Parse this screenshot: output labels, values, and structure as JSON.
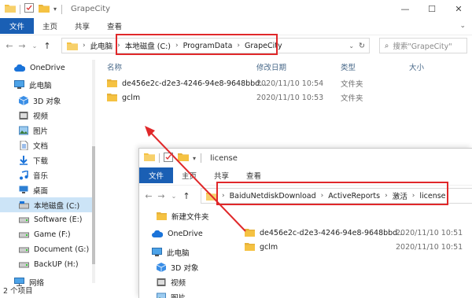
{
  "back_window": {
    "title": "GrapeCity",
    "ribbon_tabs": [
      "文件",
      "主页",
      "共享",
      "查看"
    ],
    "address_root": "此电脑",
    "address_crumbs": [
      "本地磁盘 (C:)",
      "ProgramData",
      "GrapeCity"
    ],
    "search_placeholder": "搜索\"GrapeCity\"",
    "columns": {
      "name": "名称",
      "modified": "修改日期",
      "type": "类型",
      "size": "大小"
    },
    "files": [
      {
        "name": "de456e2c-d2e3-4246-94e8-9648bbd...",
        "modified": "2020/11/10 10:54",
        "type": "文件夹"
      },
      {
        "name": "gclm",
        "modified": "2020/11/10 10:53",
        "type": "文件夹"
      }
    ],
    "nav": {
      "onedrive": "OneDrive",
      "this_pc": "此电脑",
      "objects3d": "3D 对象",
      "videos": "视频",
      "pictures": "图片",
      "documents": "文档",
      "downloads": "下载",
      "music": "音乐",
      "desktop": "桌面",
      "drive_c": "本地磁盘 (C:)",
      "drive_e": "Software (E:)",
      "drive_f": "Game (F:)",
      "drive_g": "Document (G:)",
      "drive_h": "BackUP (H:)",
      "network": "网络"
    },
    "status": "2 个项目"
  },
  "front_window": {
    "title": "license",
    "ribbon_tabs": [
      "文件",
      "主页",
      "共享",
      "查看"
    ],
    "address_crumbs": [
      "BaiduNetdiskDownload",
      "ActiveReports",
      "激活",
      "license"
    ],
    "nav": {
      "new_folder": "新建文件夹",
      "onedrive": "OneDrive",
      "this_pc": "此电脑",
      "objects3d": "3D 对象",
      "videos": "视频",
      "pictures": "图片"
    },
    "files": [
      {
        "name": "de456e2c-d2e3-4246-94e8-9648bbd...",
        "modified": "2020/11/10 10:51"
      },
      {
        "name": "gclm",
        "modified": "2020/11/10 10:51"
      }
    ]
  },
  "colors": {
    "accent": "#1a5fb4",
    "highlight_red": "#e0282a",
    "folder_yellow": "#f5c242",
    "selection": "#cce4f7"
  }
}
